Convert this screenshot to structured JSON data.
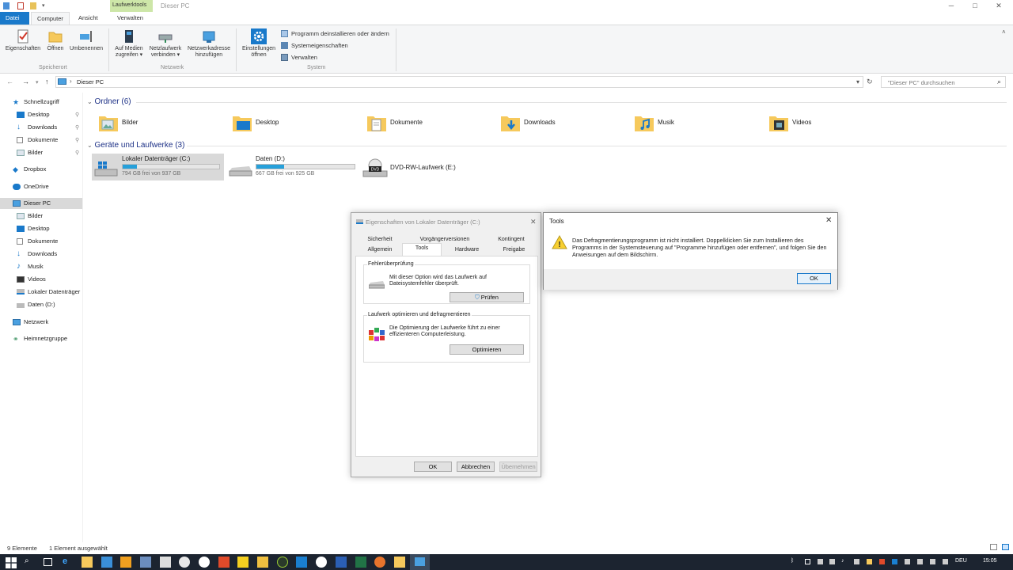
{
  "titlebar": {
    "context_tab": "Laufwerktools",
    "window_title": "Dieser PC",
    "minimize": "─",
    "maximize": "□",
    "close": "✕"
  },
  "ribbon_tabs": [
    "Datei",
    "Computer",
    "Ansicht",
    "Verwalten"
  ],
  "ribbon": {
    "buttons": {
      "eigenschaften": "Eigenschaften",
      "oeffnen": "Öffnen",
      "umbenennen": "Umbenennen",
      "medien_l1": "Auf Medien",
      "medien_l2": "zugreifen ▾",
      "netz_l1": "Netzlaufwerk",
      "netz_l2": "verbinden ▾",
      "netzadr_l1": "Netzwerkadresse",
      "netzadr_l2": "hinzufügen",
      "einst_l1": "Einstellungen",
      "einst_l2": "öffnen",
      "programm": "Programm deinstallieren oder ändern",
      "systemeig": "Systemeigenschaften",
      "verwalten": "Verwalten"
    },
    "groups": {
      "speicherort": "Speicherort",
      "netzwerk": "Netzwerk",
      "system": "System"
    }
  },
  "addressbar": {
    "back": "←",
    "forward": "→",
    "recent": "▾",
    "up": "↑",
    "path": "Dieser PC",
    "chevron": "›",
    "dropdown": "▾",
    "refresh": "↻",
    "search_placeholder": "\"Dieser PC\" durchsuchen",
    "search_icon": "⌕"
  },
  "navpane": {
    "schnellzugriff": "Schnellzugriff",
    "desktop": "Desktop",
    "downloads": "Downloads",
    "dokumente": "Dokumente",
    "bilder": "Bilder",
    "dropbox": "Dropbox",
    "onedrive": "OneDrive",
    "dieser_pc": "Dieser PC",
    "pc_bilder": "Bilder",
    "pc_desktop": "Desktop",
    "pc_dokumente": "Dokumente",
    "pc_downloads": "Downloads",
    "pc_musik": "Musik",
    "pc_videos": "Videos",
    "pc_lokal": "Lokaler Datenträger",
    "pc_daten": "Daten (D:)",
    "netzwerk": "Netzwerk",
    "heimnetz": "Heimnetzgruppe",
    "pin": "📌"
  },
  "content": {
    "folders_header": "Ordner (6)",
    "folders": [
      "Bilder",
      "Desktop",
      "Dokumente",
      "Downloads",
      "Musik",
      "Videos"
    ],
    "drives_header": "Geräte und Laufwerke (3)",
    "drives": {
      "c_name": "Lokaler Datenträger (C:)",
      "c_free": "794 GB frei von 937 GB",
      "c_used": 0.15,
      "d_name": "Daten (D:)",
      "d_free": "667 GB frei von 925 GB",
      "d_used": 0.28,
      "e_name": "DVD-RW-Laufwerk (E:)",
      "e_label": "DVD"
    }
  },
  "status": {
    "count": "9 Elemente",
    "selected": "1 Element ausgewählt"
  },
  "props_dialog": {
    "title": "Eigenschaften von Lokaler Datenträger (C:)",
    "close": "✕",
    "tabs_row1": [
      "Sicherheit",
      "Vorgängerversionen",
      "Kontingent"
    ],
    "tabs_row2": [
      "Allgemein",
      "Tools",
      "Hardware",
      "Freigabe"
    ],
    "error_group": "Fehlerüberprüfung",
    "error_text": "Mit dieser Option wird das Laufwerk auf Dateisystemfehler überprüft.",
    "check_btn": "Prüfen",
    "opt_group": "Laufwerk optimieren und defragmentieren",
    "opt_text": "Die Optimierung der Laufwerke führt zu einer effizienteren Computerleistung.",
    "opt_btn": "Optimieren",
    "ok": "OK",
    "cancel": "Abbrechen",
    "apply": "Übernehmen"
  },
  "msgbox": {
    "title": "Tools",
    "close": "✕",
    "text": "Das Defragmentierungsprogramm ist nicht installiert. Doppelklicken Sie zum Installieren des Programms in der Systemsteuerung auf \"Programme hinzufügen oder entfernen\", und folgen Sie den Anweisungen auf dem Bildschirm.",
    "warning": "!",
    "ok": "OK"
  },
  "taskbar": {
    "language": "DEU",
    "time": "15:05"
  },
  "colors": {
    "accent": "#1979ca",
    "drive_bar": "#26a0da",
    "folder": "#f6c95c",
    "taskbar": "#1c2430"
  }
}
